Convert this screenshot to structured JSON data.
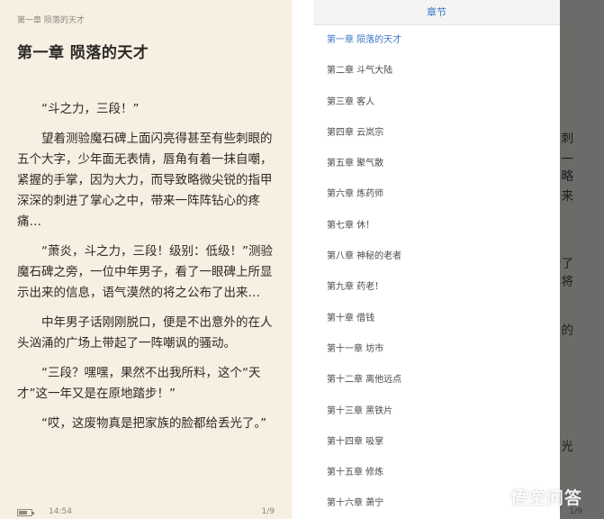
{
  "reader": {
    "crumb": "第一章 陨落的天才",
    "title": "第一章 陨落的天才",
    "paragraphs": [
      "“斗之力，三段！”",
      "望着测验魔石碑上面闪亮得甚至有些刺眼的五个大字，少年面无表情，唇角有着一抹自嘲，紧握的手掌，因为大力，而导致略微尖锐的指甲深深的刺进了掌心之中，带来一阵阵钻心的疼痛…",
      "“萧炎，斗之力，三段！级别：低级！”测验魔石碑之旁，一位中年男子，看了一眼碑上所显示出来的信息，语气漠然的将之公布了出来…",
      "中年男子话刚刚脱口，便是不出意外的在人头汹涌的广场上带起了一阵嘲讽的骚动。",
      "“三段？嘿嘿，果然不出我所料，这个“天才”这一年又是在原地踏步！”",
      "“哎，这废物真是把家族的脸都给丢光了。”"
    ],
    "status": {
      "time": "14:54",
      "page": "1/9"
    }
  },
  "dim_fragments": [
    "刺",
    "一",
    "略",
    "来",
    "看了",
    "将",
    "的",
    "光"
  ],
  "dim_page": "1/9",
  "toc": {
    "header": "章节",
    "chapters": [
      "第一章 陨落的天才",
      "第二章 斗气大陆",
      "第三章 客人",
      "第四章 云岚宗",
      "第五章 聚气散",
      "第六章 炼药师",
      "第七章 休！",
      "第八章 神秘的老者",
      "第九章 药老！",
      "第十章 借钱",
      "第十一章 坊市",
      "第十二章 离他远点",
      "第十三章 黑铁片",
      "第十四章 吸掌",
      "第十五章 修炼",
      "第十六章 萧宁"
    ],
    "active_index": 0
  },
  "watermark": {
    "text": "悟空问答"
  },
  "colors": {
    "accent": "#3c78c8",
    "paper": "#f6efe2",
    "overlay": "#6d6b69"
  }
}
